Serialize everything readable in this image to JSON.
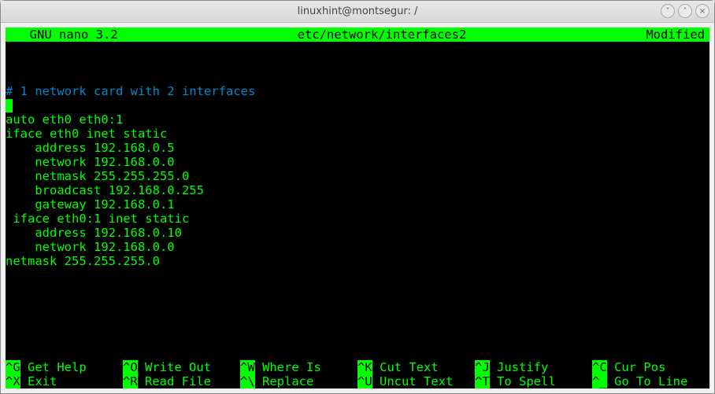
{
  "window": {
    "title": "linuxhint@montsegur: /",
    "controls": {
      "min": "˅",
      "max": "˄",
      "close": "×"
    }
  },
  "nano": {
    "app": "  GNU nano 3.2",
    "file": "etc/network/interfaces2",
    "status": "Modified"
  },
  "editor": {
    "blank_top": "\n\n\n",
    "comment": "# 1 network card with 2 interfaces",
    "body": "\nauto eth0 eth0:1\niface eth0 inet static\n    address 192.168.0.5\n    network 192.168.0.0\n    netmask 255.255.255.0\n    broadcast 192.168.0.255\n    gateway 192.168.0.1\n iface eth0:1 inet static\n    address 192.168.0.10\n    network 192.168.0.0\nnetmask 255.255.255.0\n\n"
  },
  "shortcuts": {
    "row1": [
      {
        "key": "^G",
        "label": " Get Help"
      },
      {
        "key": "^O",
        "label": " Write Out"
      },
      {
        "key": "^W",
        "label": " Where Is"
      },
      {
        "key": "^K",
        "label": " Cut Text"
      },
      {
        "key": "^J",
        "label": " Justify"
      },
      {
        "key": "^C",
        "label": " Cur Pos"
      }
    ],
    "row2": [
      {
        "key": "^X",
        "label": " Exit"
      },
      {
        "key": "^R",
        "label": " Read File"
      },
      {
        "key": "^\\",
        "label": " Replace"
      },
      {
        "key": "^U",
        "label": " Uncut Text"
      },
      {
        "key": "^T",
        "label": " To Spell"
      },
      {
        "key": "^_",
        "label": " Go To Line"
      }
    ]
  }
}
